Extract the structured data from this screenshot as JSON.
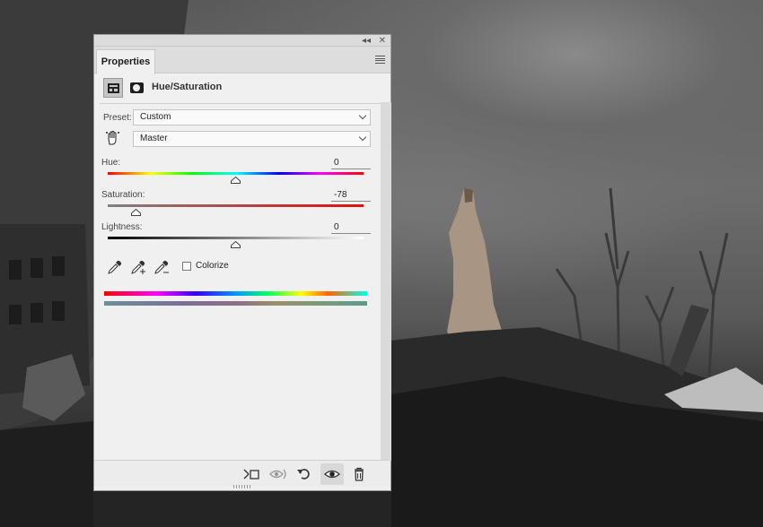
{
  "panel": {
    "tab_label": "Properties",
    "adjustment_title": "Hue/Saturation",
    "preset_label": "Preset:",
    "preset_value": "Custom",
    "channel_value": "Master",
    "sliders": [
      {
        "label": "Hue:",
        "value": "0",
        "level": 0.5
      },
      {
        "label": "Saturation:",
        "value": "-78",
        "level": 0.11
      },
      {
        "label": "Lightness:",
        "value": "0",
        "level": 0.5
      }
    ],
    "colorize_label": "Colorize",
    "colorize_checked": false,
    "footer_icons": [
      "clip-to-layer-icon",
      "view-previous-state-icon",
      "reset-icon",
      "visibility-eye-icon",
      "trash-icon"
    ]
  },
  "colors": {
    "panel_bg": "#f0f0f0",
    "tab_bg": "#dddddd",
    "text": "#222222"
  }
}
